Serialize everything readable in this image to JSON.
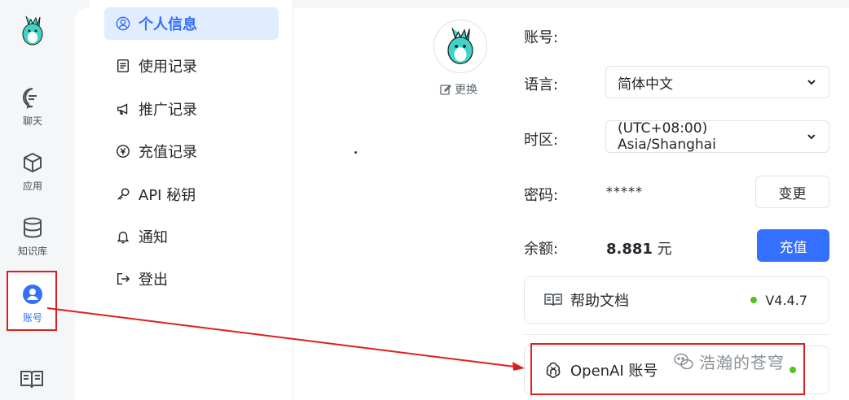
{
  "rail": {
    "items": [
      {
        "label": "聊天",
        "icon": "chat-icon"
      },
      {
        "label": "应用",
        "icon": "cube-icon"
      },
      {
        "label": "知识库",
        "icon": "database-icon"
      },
      {
        "label": "账号",
        "icon": "user-icon"
      }
    ]
  },
  "submenu": {
    "items": [
      {
        "label": "个人信息",
        "icon": "user-circle-icon"
      },
      {
        "label": "使用记录",
        "icon": "doc-icon"
      },
      {
        "label": "推广记录",
        "icon": "megaphone-icon"
      },
      {
        "label": "充值记录",
        "icon": "coin-icon"
      },
      {
        "label": "API 秘钥",
        "icon": "key-icon"
      },
      {
        "label": "通知",
        "icon": "bell-icon"
      },
      {
        "label": "登出",
        "icon": "logout-icon"
      }
    ]
  },
  "profile": {
    "change_avatar": "更换",
    "account_label": "账号:",
    "language_label": "语言:",
    "language_value": "简体中文",
    "timezone_label": "时区:",
    "timezone_value": "(UTC+08:00) Asia/Shanghai",
    "password_label": "密码:",
    "password_mask": "*****",
    "password_button": "变更",
    "balance_label": "余额:",
    "balance_amount": "8.881",
    "balance_unit": "元",
    "recharge_button": "充值"
  },
  "cards": {
    "help_label": "帮助文档",
    "version": "V4.4.7",
    "openai_label": "OpenAI 账号"
  },
  "watermark": "浩瀚的苍穹",
  "colors": {
    "accent": "#3370ff",
    "highlight": "#e01e1e",
    "status": "#52c41a"
  }
}
